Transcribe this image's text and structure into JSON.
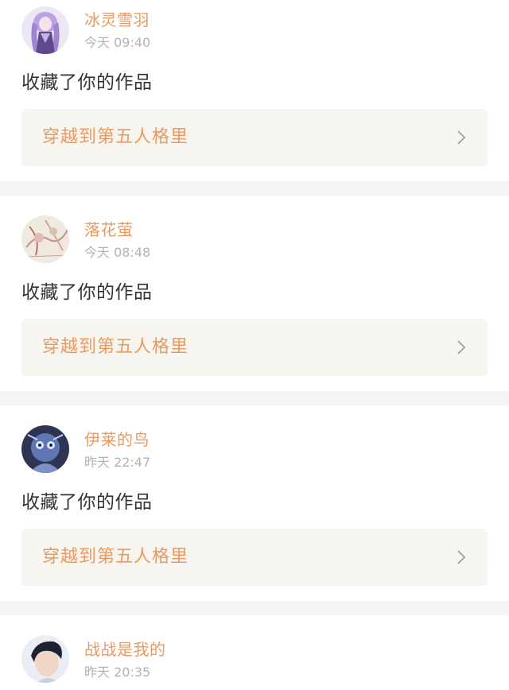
{
  "notifications": [
    {
      "username": "冰灵雪羽",
      "time": "今天 09:40",
      "action": "收藏了你的作品",
      "work_title": "穿越到第五人格里",
      "avatar_icon": "anime-girl-purple-avatar"
    },
    {
      "username": "落花萤",
      "time": "今天 08:48",
      "action": "收藏了你的作品",
      "work_title": "穿越到第五人格里",
      "avatar_icon": "sketch-floral-avatar"
    },
    {
      "username": "伊莱的鸟",
      "time": "昨天 22:47",
      "action": "收藏了你的作品",
      "work_title": "穿越到第五人格里",
      "avatar_icon": "blue-owl-character-avatar"
    },
    {
      "username": "战战是我的",
      "time": "昨天 20:35",
      "action": "",
      "work_title": "",
      "avatar_icon": "boy-portrait-avatar"
    }
  ],
  "colors": {
    "username": "#e89a62",
    "timestamp": "#b3b3b3",
    "action": "#333333",
    "card_bg": "#f6f5ef",
    "separator": "#f5f4f2"
  }
}
